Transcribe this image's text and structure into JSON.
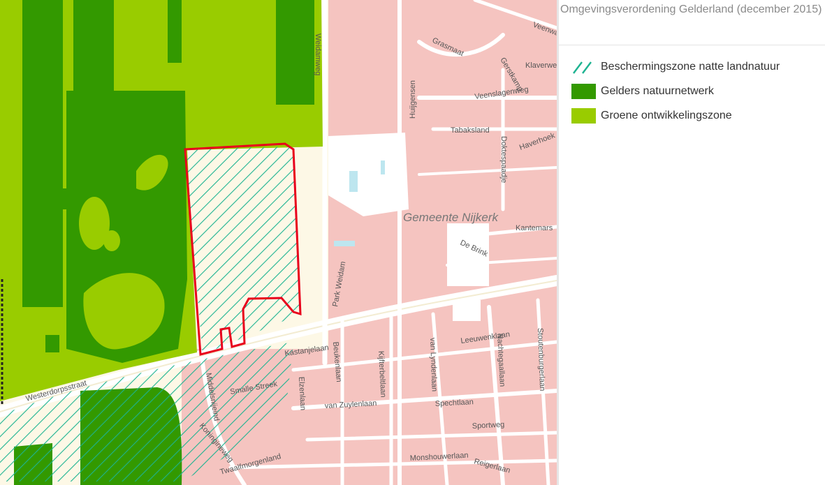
{
  "panel": {
    "title": "Omgevingsverordening Gelderland (december 2015)",
    "legend": [
      {
        "label": "Beschermingszone natte landnatuur",
        "symbol": "hatch",
        "color": "#1db391"
      },
      {
        "label": "Gelders natuurnetwerk",
        "symbol": "fill",
        "color": "#339900"
      },
      {
        "label": "Groene ontwikkelingszone",
        "symbol": "fill",
        "color": "#99cc00"
      }
    ]
  },
  "map": {
    "colors": {
      "background": "#fdf8e6",
      "buildings": "#f5c4c0",
      "roads": "#ffffff",
      "water": "#bde6ef",
      "parcel_outline": "#e8001c"
    },
    "area_label": "Gemeente  Nijkerk",
    "street_labels": [
      "Veenwal",
      "Grasmaat",
      "Klaverweide",
      "Gerstkamp",
      "Veenslagenweg",
      "Huijgensen",
      "Tabaksland",
      "Doktespaadje",
      "Haverhoek",
      "Kantemars",
      "De Brink",
      "Park Weidam",
      "Weidamweg",
      "Kastanjelaan",
      "Beukenlaan",
      "Kijfterbeltlaan",
      "van Lyndenlaan",
      "Leeuwenklaan",
      "Nachtegaallaan",
      "Stoutenburgerlaan",
      "Elzenlaan",
      "van Zuylenlaan",
      "Spechtlaan",
      "Sportweg",
      "Smalle Streek",
      "Westerdorpsstraat",
      "Middelsnijeind",
      "Koningineweg",
      "Monshouwerlaan",
      "Reigerlaan",
      "Twaalfmorgenland"
    ]
  }
}
